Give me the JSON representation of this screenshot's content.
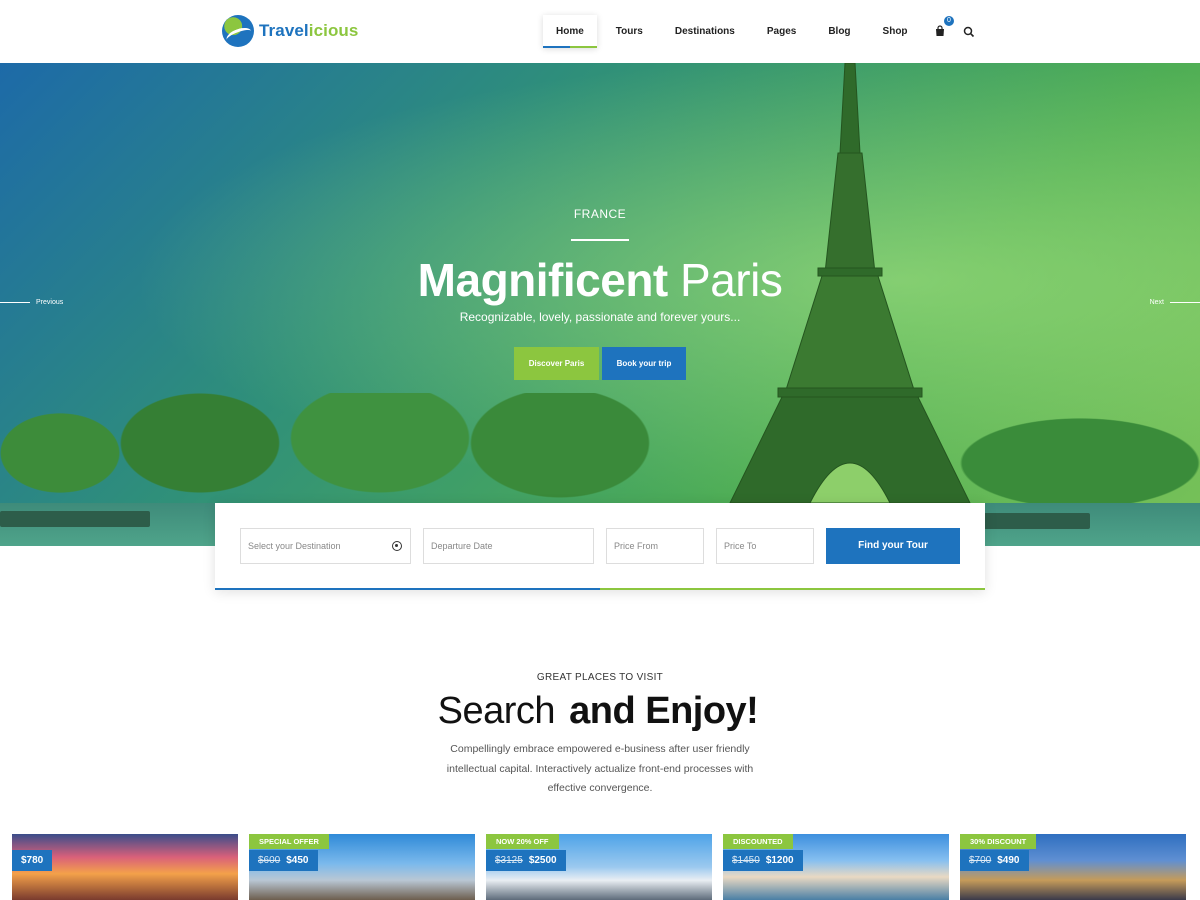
{
  "header": {
    "logo_text_a": "Travel",
    "logo_text_b": "icious",
    "nav": [
      "Home",
      "Tours",
      "Destinations",
      "Pages",
      "Blog",
      "Shop"
    ],
    "cart_count": "0",
    "accent_blue": "#1e73be",
    "accent_green": "#8cc63f"
  },
  "hero": {
    "eyebrow": "FRANCE",
    "title_bold": "Magnificent",
    "title_light": "Paris",
    "subtitle": "Recognizable, lovely, passionate and forever yours...",
    "discover_label": "Discover Paris",
    "book_label": "Book your trip",
    "prev_label": "Previous",
    "next_label": "Next"
  },
  "search": {
    "destination_placeholder": "Select your Destination",
    "date_placeholder": "Departure Date",
    "price_from_placeholder": "Price From",
    "price_to_placeholder": "Price To",
    "find_label": "Find your Tour"
  },
  "section": {
    "eyebrow": "GREAT PLACES TO VISIT",
    "title_light": "Search",
    "title_bold": "and Enjoy!",
    "description": "Compellingly embrace empowered e-business after user friendly intellectual capital. Interactively actualize front-end processes with effective convergence."
  },
  "cards": [
    {
      "tag": "",
      "old_price": "",
      "price": "$780"
    },
    {
      "tag": "SPECIAL OFFER",
      "old_price": "$600",
      "price": "$450"
    },
    {
      "tag": "NOW 20% OFF",
      "old_price": "$3125",
      "price": "$2500"
    },
    {
      "tag": "DISCOUNTED",
      "old_price": "$1450",
      "price": "$1200"
    },
    {
      "tag": "30% DISCOUNT",
      "old_price": "$700",
      "price": "$490"
    }
  ]
}
